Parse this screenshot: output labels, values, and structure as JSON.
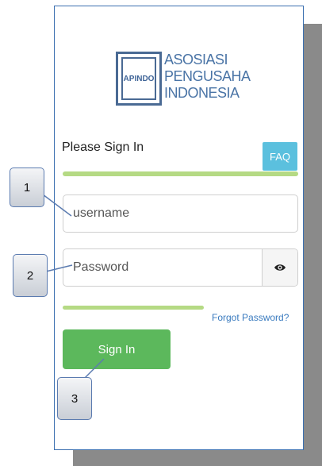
{
  "logo": {
    "mark": "APINDO",
    "lines": [
      "ASOSIASI",
      "PENGUSAHA",
      "INDONESIA"
    ]
  },
  "form": {
    "title": "Please Sign In",
    "faq_label": "FAQ",
    "username_placeholder": "username",
    "password_placeholder": "Password",
    "forgot_label": "Forgot Password?",
    "signin_label": "Sign In"
  },
  "callouts": [
    "1",
    "2",
    "3"
  ],
  "colors": {
    "faq": "#5bc0de",
    "signin": "#5cb85c",
    "accent_bar": "#b5da84",
    "link": "#3a7bbf"
  }
}
